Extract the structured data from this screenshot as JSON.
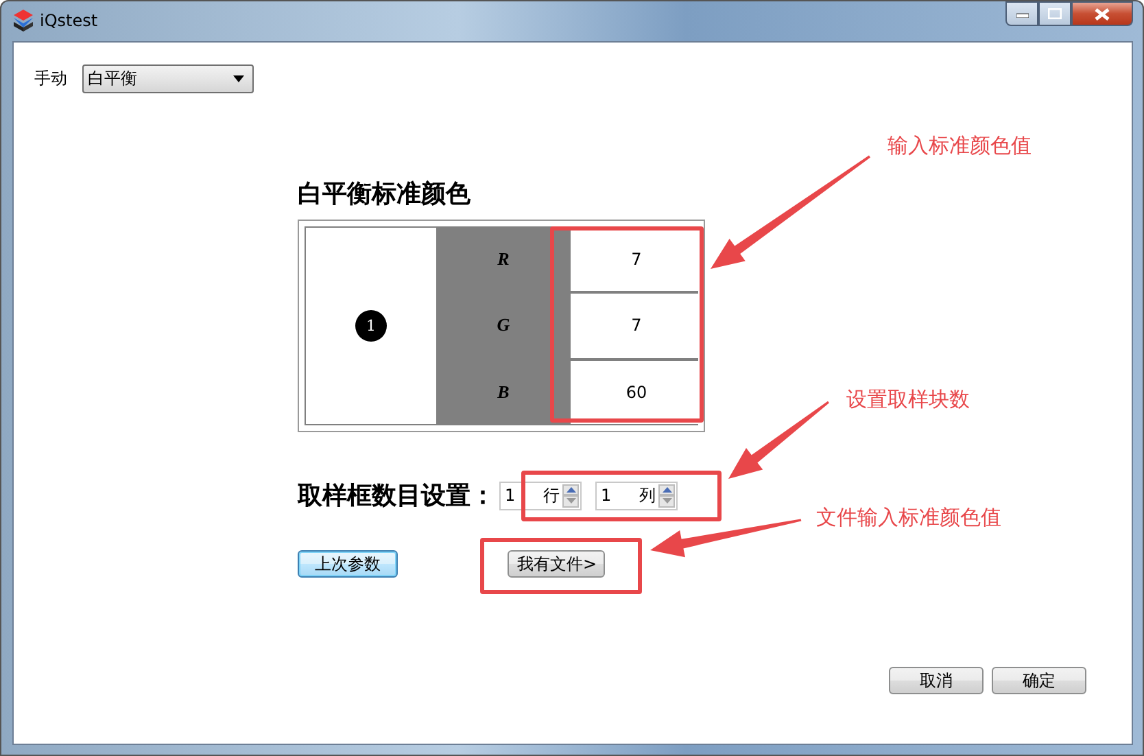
{
  "window": {
    "title": "iQstest"
  },
  "mode": {
    "label": "手动",
    "value": "白平衡"
  },
  "standard_color": {
    "title": "白平衡标准颜色",
    "marker": "1",
    "channels": [
      {
        "name": "R",
        "value": "7"
      },
      {
        "name": "G",
        "value": "7"
      },
      {
        "name": "B",
        "value": "60"
      }
    ]
  },
  "sampling": {
    "label": "取样框数目设置：",
    "fields": [
      {
        "value": "1",
        "unit": "行"
      },
      {
        "value": "1",
        "unit": "列"
      }
    ]
  },
  "last_params_button": "上次参数",
  "file_button": "我有文件>",
  "dialog_buttons": [
    "取消",
    "确定"
  ],
  "annotations": [
    {
      "text": "输入标准颜色值"
    },
    {
      "text": "设置取样块数"
    },
    {
      "text": "文件输入标准颜色值"
    }
  ]
}
